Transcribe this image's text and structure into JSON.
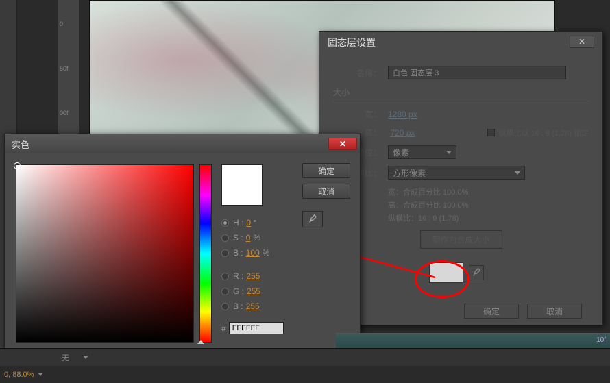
{
  "ruler_marks": [
    "0",
    "50f",
    "00f"
  ],
  "solid_dialog": {
    "title": "固态层设置",
    "name_label": "名称：",
    "name_value": "白色 固态层 3",
    "size_label": "大小",
    "width_label": "宽：",
    "width_value": "1280 px",
    "height_label": "高：",
    "height_value": "720 px",
    "lock_aspect_label": "纵横比以 16 : 9 (1.78) 锁定",
    "unit_label": "单位：",
    "unit_value": "像素",
    "aspect_label": "纵横比：",
    "aspect_value": "方形像素",
    "info_w": "宽：合成百分比 100.0%",
    "info_h": "高：合成百分比 100.0%",
    "info_ratio": "纵横比：16 : 9 (1.78)",
    "make_comp_size": "制作为合成大小",
    "ok": "确定",
    "cancel": "取消"
  },
  "color_picker": {
    "title": "实色",
    "ok": "确定",
    "cancel": "取消",
    "h_label": "H :",
    "h_value": "0",
    "h_unit": "°",
    "s_label": "S :",
    "s_value": "0",
    "s_unit": "%",
    "b_label": "B :",
    "b_value": "100",
    "b_unit": "%",
    "r_label": "R :",
    "r_value": "255",
    "g_label": "G :",
    "g_value": "255",
    "bb_label": "B :",
    "bb_value": "255",
    "hash": "#",
    "hex_value": "FFFFFF"
  },
  "timeline": {
    "dropdown": "无",
    "zoom": "0, 88.0%"
  }
}
